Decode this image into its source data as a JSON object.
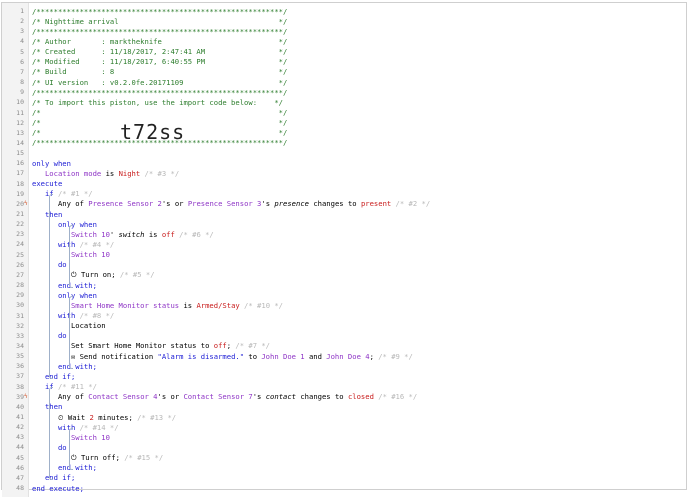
{
  "lines": [
    {
      "n": "1",
      "segments": [
        {
          "t": "/*********************************************************/",
          "c": "cmt"
        }
      ]
    },
    {
      "n": "2",
      "segments": [
        {
          "t": "/* Nighttime arrival                                     */",
          "c": "cmt"
        }
      ]
    },
    {
      "n": "3",
      "segments": [
        {
          "t": "/*********************************************************/",
          "c": "cmt"
        }
      ]
    },
    {
      "n": "4",
      "segments": [
        {
          "t": "/* Author       : marktheknife                           */",
          "c": "cmt"
        }
      ]
    },
    {
      "n": "5",
      "segments": [
        {
          "t": "/* Created      : 11/18/2017, 2:47:41 AM                 */",
          "c": "cmt"
        }
      ]
    },
    {
      "n": "6",
      "segments": [
        {
          "t": "/* Modified     : 11/18/2017, 6:40:55 PM                 */",
          "c": "cmt"
        }
      ]
    },
    {
      "n": "7",
      "segments": [
        {
          "t": "/* Build        : 8                                      */",
          "c": "cmt"
        }
      ]
    },
    {
      "n": "8",
      "segments": [
        {
          "t": "/* UI version   : v0.2.0fe.20171109                      */",
          "c": "cmt"
        }
      ]
    },
    {
      "n": "9",
      "segments": [
        {
          "t": "/*********************************************************/",
          "c": "cmt"
        }
      ]
    },
    {
      "n": "10",
      "segments": [
        {
          "t": "/* To import this piston, use the import code below:    */",
          "c": "cmt"
        }
      ]
    },
    {
      "n": "11",
      "segments": [
        {
          "t": "/*                                                       */",
          "c": "cmt"
        }
      ]
    },
    {
      "n": "12",
      "segments": [
        {
          "t": "/*                                                       */",
          "c": "cmt"
        }
      ]
    },
    {
      "n": "13",
      "segments": [
        {
          "t": "/*                                                       */",
          "c": "cmt"
        }
      ]
    },
    {
      "n": "14",
      "segments": [
        {
          "t": "/*********************************************************/",
          "c": "cmt"
        }
      ]
    },
    {
      "n": "15",
      "segments": []
    },
    {
      "n": "16",
      "segments": [
        {
          "t": "only when",
          "c": "kw"
        }
      ]
    },
    {
      "n": "17",
      "segments": [
        {
          "t": "   Location mode",
          "c": "dev"
        },
        {
          "t": " is ",
          "c": "op"
        },
        {
          "t": "Night",
          "c": "val"
        },
        {
          "t": " /* #3 */",
          "c": "id"
        }
      ]
    },
    {
      "n": "18",
      "segments": [
        {
          "t": "execute",
          "c": "kw"
        }
      ]
    },
    {
      "n": "19",
      "segments": [
        {
          "t": "   if",
          "c": "kw"
        },
        {
          "t": " /* #1 */",
          "c": "id"
        }
      ]
    },
    {
      "n": "20",
      "segments": [
        {
          "t": "      Any of ",
          "c": "op"
        },
        {
          "t": "Presence Sensor 2",
          "c": "dev"
        },
        {
          "t": "'s or ",
          "c": "op"
        },
        {
          "t": "Presence Sensor 3",
          "c": "dev"
        },
        {
          "t": "'s ",
          "c": "op"
        },
        {
          "t": "presence",
          "c": "attr"
        },
        {
          "t": " changes to ",
          "c": "op"
        },
        {
          "t": "present",
          "c": "val"
        },
        {
          "t": " /* #2 */",
          "c": "id"
        }
      ]
    },
    {
      "n": "21",
      "segments": [
        {
          "t": "   then",
          "c": "kw"
        }
      ]
    },
    {
      "n": "22",
      "segments": [
        {
          "t": "      only when",
          "c": "kw"
        }
      ]
    },
    {
      "n": "23",
      "segments": [
        {
          "t": "         Switch 10",
          "c": "dev"
        },
        {
          "t": "' ",
          "c": "op"
        },
        {
          "t": "switch",
          "c": "attr"
        },
        {
          "t": " is ",
          "c": "op"
        },
        {
          "t": "off",
          "c": "val"
        },
        {
          "t": " /* #6 */",
          "c": "id"
        }
      ]
    },
    {
      "n": "24",
      "segments": [
        {
          "t": "      with",
          "c": "kw"
        },
        {
          "t": " /* #4 */",
          "c": "id"
        }
      ]
    },
    {
      "n": "25",
      "segments": [
        {
          "t": "         Switch 10",
          "c": "dev"
        }
      ]
    },
    {
      "n": "26",
      "segments": [
        {
          "t": "      do",
          "c": "kw"
        }
      ]
    },
    {
      "n": "27",
      "segments": [
        {
          "t": "         ⏻ Turn on;",
          "c": "op"
        },
        {
          "t": " /* #5 */",
          "c": "id"
        }
      ]
    },
    {
      "n": "28",
      "segments": [
        {
          "t": "      end with;",
          "c": "kw"
        }
      ]
    },
    {
      "n": "29",
      "segments": [
        {
          "t": "      only when",
          "c": "kw"
        }
      ]
    },
    {
      "n": "30",
      "segments": [
        {
          "t": "         Smart Home Monitor status",
          "c": "dev"
        },
        {
          "t": " is ",
          "c": "op"
        },
        {
          "t": "Armed/Stay",
          "c": "val"
        },
        {
          "t": " /* #10 */",
          "c": "id"
        }
      ]
    },
    {
      "n": "31",
      "segments": [
        {
          "t": "      with",
          "c": "kw"
        },
        {
          "t": " /* #8 */",
          "c": "id"
        }
      ]
    },
    {
      "n": "32",
      "segments": [
        {
          "t": "         Location",
          "c": "op"
        }
      ]
    },
    {
      "n": "33",
      "segments": [
        {
          "t": "      do",
          "c": "kw"
        }
      ]
    },
    {
      "n": "34",
      "segments": [
        {
          "t": "         Set Smart Home Monitor status to ",
          "c": "op"
        },
        {
          "t": "off",
          "c": "val"
        },
        {
          "t": ";",
          "c": "op"
        },
        {
          "t": " /* #7 */",
          "c": "id"
        }
      ]
    },
    {
      "n": "35",
      "segments": [
        {
          "t": "         ✉ Send notification ",
          "c": "op"
        },
        {
          "t": "\"Alarm is disarmed.\"",
          "c": "kw"
        },
        {
          "t": " to ",
          "c": "op"
        },
        {
          "t": "John Doe 1",
          "c": "dev"
        },
        {
          "t": " and ",
          "c": "op"
        },
        {
          "t": "John Doe 4",
          "c": "dev"
        },
        {
          "t": ";",
          "c": "op"
        },
        {
          "t": " /* #9 */",
          "c": "id"
        }
      ]
    },
    {
      "n": "36",
      "segments": [
        {
          "t": "      end with;",
          "c": "kw"
        }
      ]
    },
    {
      "n": "37",
      "segments": [
        {
          "t": "   end if;",
          "c": "kw"
        }
      ]
    },
    {
      "n": "38",
      "segments": [
        {
          "t": "   if",
          "c": "kw"
        },
        {
          "t": " /* #11 */",
          "c": "id"
        }
      ]
    },
    {
      "n": "39",
      "segments": [
        {
          "t": "      Any of ",
          "c": "op"
        },
        {
          "t": "Contact Sensor 4",
          "c": "dev"
        },
        {
          "t": "'s or ",
          "c": "op"
        },
        {
          "t": "Contact Sensor 7",
          "c": "dev"
        },
        {
          "t": "'s ",
          "c": "op"
        },
        {
          "t": "contact",
          "c": "attr"
        },
        {
          "t": " changes to ",
          "c": "op"
        },
        {
          "t": "closed",
          "c": "val"
        },
        {
          "t": " /* #16 */",
          "c": "id"
        }
      ]
    },
    {
      "n": "40",
      "segments": [
        {
          "t": "   then",
          "c": "kw"
        }
      ]
    },
    {
      "n": "41",
      "segments": [
        {
          "t": "      ⏲ Wait ",
          "c": "op"
        },
        {
          "t": "2",
          "c": "num"
        },
        {
          "t": " minutes;",
          "c": "op"
        },
        {
          "t": " /* #13 */",
          "c": "id"
        }
      ]
    },
    {
      "n": "42",
      "segments": [
        {
          "t": "      with",
          "c": "kw"
        },
        {
          "t": " /* #14 */",
          "c": "id"
        }
      ]
    },
    {
      "n": "43",
      "segments": [
        {
          "t": "         Switch 10",
          "c": "dev"
        }
      ]
    },
    {
      "n": "44",
      "segments": [
        {
          "t": "      do",
          "c": "kw"
        }
      ]
    },
    {
      "n": "45",
      "segments": [
        {
          "t": "         ⏻ Turn off;",
          "c": "op"
        },
        {
          "t": " /* #15 */",
          "c": "id"
        }
      ]
    },
    {
      "n": "46",
      "segments": [
        {
          "t": "      end with;",
          "c": "kw"
        }
      ]
    },
    {
      "n": "47",
      "segments": [
        {
          "t": "   end if;",
          "c": "kw"
        }
      ]
    },
    {
      "n": "48",
      "segments": [
        {
          "t": "end execute;",
          "c": "kw"
        }
      ]
    }
  ],
  "import_code": "t72ss",
  "markers": [
    {
      "line": "20",
      "symbol": "ϟ"
    },
    {
      "line": "39",
      "symbol": "ϟ"
    }
  ]
}
